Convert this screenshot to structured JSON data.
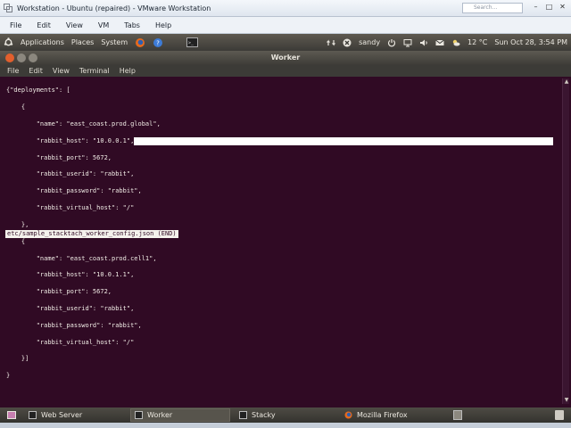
{
  "vmware": {
    "title": "Workstation - Ubuntu (repaired) - VMware Workstation",
    "menu": [
      "File",
      "Edit",
      "View",
      "VM",
      "Tabs",
      "Help"
    ],
    "search_placeholder": "Search..."
  },
  "ubuntu_panel": {
    "applications": "Applications",
    "places": "Places",
    "system": "System",
    "user": "sandy",
    "temperature": "12 °C",
    "clock": "Sun Oct 28,  3:54 PM"
  },
  "terminal": {
    "title": "Worker",
    "menu": [
      "File",
      "Edit",
      "View",
      "Terminal",
      "Help"
    ],
    "lines": [
      "{\"deployments\": [",
      "    {",
      "        \"name\": \"east_coast.prod.global\",",
      "        \"rabbit_host\": \"10.0.0.1\",",
      "        \"rabbit_port\": 5672,",
      "        \"rabbit_userid\": \"rabbit\",",
      "        \"rabbit_password\": \"rabbit\",",
      "        \"rabbit_virtual_host\": \"/\"",
      "    },",
      "    {",
      "        \"name\": \"east_coast.prod.cell1\",",
      "        \"rabbit_host\": \"10.0.1.1\",",
      "        \"rabbit_port\": 5672,",
      "        \"rabbit_userid\": \"rabbit\",",
      "        \"rabbit_password\": \"rabbit\",",
      "        \"rabbit_virtual_host\": \"/\"",
      "    }]",
      "}"
    ],
    "status": "etc/sample_stacktach_worker_config.json (END)"
  },
  "taskbar": {
    "items": [
      "Web Server",
      "Worker",
      "Stacky",
      "Mozilla Firefox"
    ],
    "active": "Worker"
  },
  "colors": {
    "terminal_bg": "#300a24",
    "panel_bg": "#3c3b37",
    "close_button": "#e25f2d"
  }
}
